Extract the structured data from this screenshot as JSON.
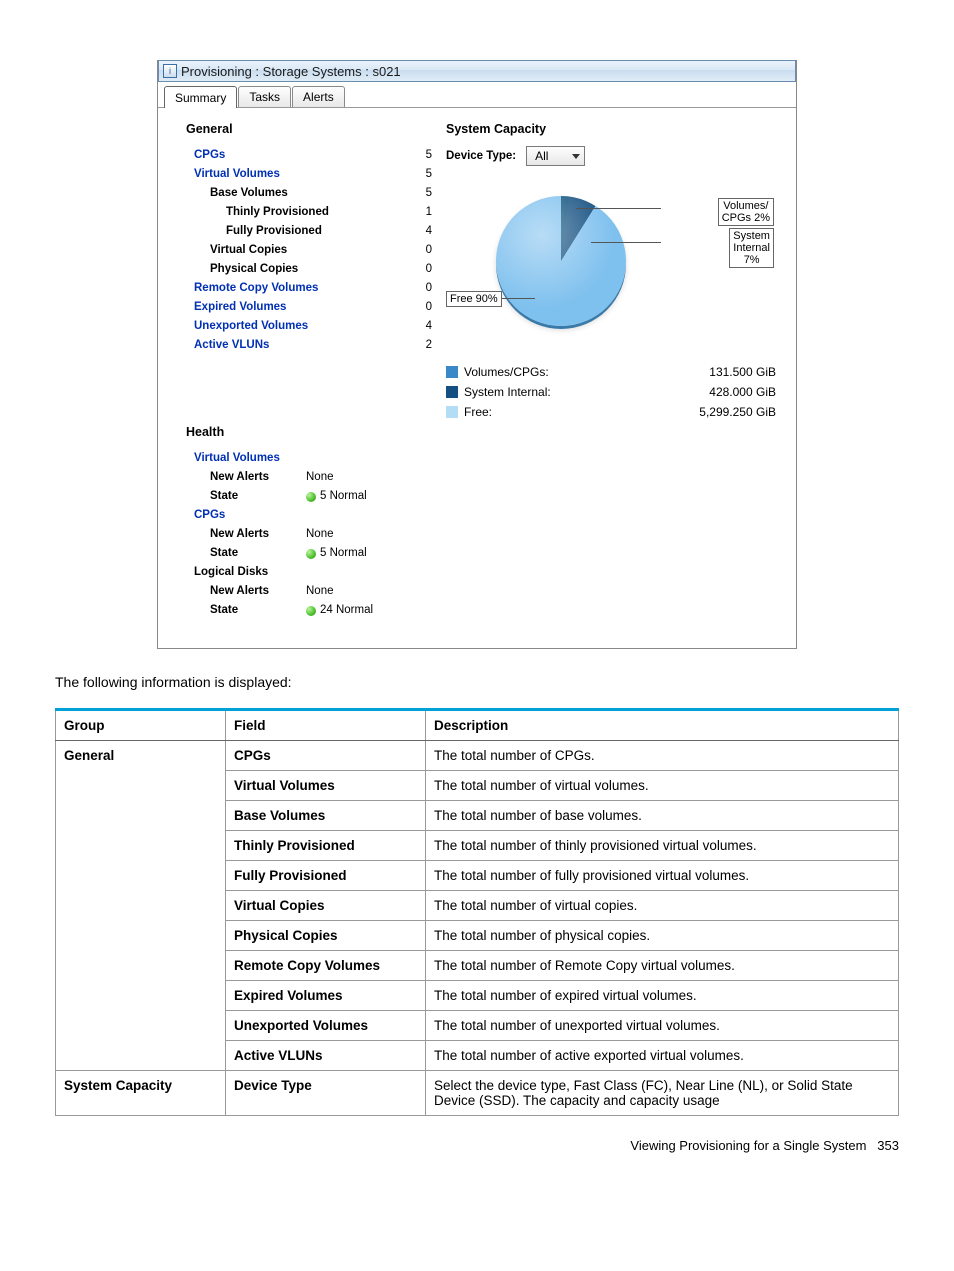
{
  "window": {
    "title": "Provisioning : Storage Systems : s021",
    "tabs": [
      "Summary",
      "Tasks",
      "Alerts"
    ],
    "active_tab": 0
  },
  "general": {
    "title": "General",
    "rows": [
      {
        "label": "CPGs",
        "link": true,
        "indent": 1,
        "value": "5"
      },
      {
        "label": "Virtual Volumes",
        "link": true,
        "indent": 1,
        "value": "5"
      },
      {
        "label": "Base Volumes",
        "link": false,
        "indent": 2,
        "value": "5"
      },
      {
        "label": "Thinly Provisioned",
        "link": false,
        "indent": 3,
        "value": "1"
      },
      {
        "label": "Fully Provisioned",
        "link": false,
        "indent": 3,
        "value": "4"
      },
      {
        "label": "Virtual Copies",
        "link": false,
        "indent": 2,
        "value": "0"
      },
      {
        "label": "Physical Copies",
        "link": false,
        "indent": 2,
        "value": "0"
      },
      {
        "label": "Remote Copy Volumes",
        "link": true,
        "indent": 1,
        "value": "0"
      },
      {
        "label": "Expired Volumes",
        "link": true,
        "indent": 1,
        "value": "0"
      },
      {
        "label": "Unexported Volumes",
        "link": true,
        "indent": 1,
        "value": "4"
      },
      {
        "label": "Active VLUNs",
        "link": true,
        "indent": 1,
        "value": "2"
      }
    ]
  },
  "capacity": {
    "title": "System Capacity",
    "device_type_label": "Device Type:",
    "device_type_value": "All",
    "callouts": {
      "volumes_cpgs": "Volumes/\nCPGs 2%",
      "system_internal": "System\nInternal\n7%",
      "free": "Free 90%"
    },
    "legend": [
      {
        "label": "Volumes/CPGs:",
        "value": "131.500 GiB",
        "sw": "sw1"
      },
      {
        "label": "System Internal:",
        "value": "428.000 GiB",
        "sw": "sw2"
      },
      {
        "label": "Free:",
        "value": "5,299.250 GiB",
        "sw": "sw3"
      }
    ]
  },
  "chart_data": {
    "type": "pie",
    "title": "System Capacity",
    "series": [
      {
        "name": "Volumes/CPGs",
        "percent": 2,
        "value_gib": 131.5
      },
      {
        "name": "System Internal",
        "percent": 7,
        "value_gib": 428.0
      },
      {
        "name": "Free",
        "percent": 90,
        "value_gib": 5299.25
      }
    ],
    "unit": "GiB"
  },
  "health": {
    "title": "Health",
    "groups": [
      {
        "name": "Virtual Volumes",
        "link": true,
        "rows": [
          {
            "label": "New Alerts",
            "value": "None",
            "dot": false
          },
          {
            "label": "State",
            "value": "5 Normal",
            "dot": true
          }
        ]
      },
      {
        "name": "CPGs",
        "link": true,
        "rows": [
          {
            "label": "New Alerts",
            "value": "None",
            "dot": false
          },
          {
            "label": "State",
            "value": "5 Normal",
            "dot": true
          }
        ]
      },
      {
        "name": "Logical Disks",
        "link": false,
        "rows": [
          {
            "label": "New Alerts",
            "value": "None",
            "dot": false
          },
          {
            "label": "State",
            "value": "24 Normal",
            "dot": true
          }
        ]
      }
    ]
  },
  "doc": {
    "intro": "The following information is displayed:"
  },
  "table": {
    "headers": [
      "Group",
      "Field",
      "Description"
    ],
    "rows": [
      {
        "group": "General",
        "field": "CPGs",
        "desc": "The total number of CPGs."
      },
      {
        "group": "",
        "field": "Virtual Volumes",
        "desc": "The total number of virtual volumes."
      },
      {
        "group": "",
        "field": "Base Volumes",
        "desc": "The total number of base volumes."
      },
      {
        "group": "",
        "field": "Thinly Provisioned",
        "desc": "The total number of thinly provisioned virtual volumes."
      },
      {
        "group": "",
        "field": "Fully Provisioned",
        "desc": "The total number of fully provisioned virtual volumes."
      },
      {
        "group": "",
        "field": "Virtual Copies",
        "desc": "The total number of virtual copies."
      },
      {
        "group": "",
        "field": "Physical Copies",
        "desc": "The total number of physical copies."
      },
      {
        "group": "",
        "field": "Remote Copy Volumes",
        "desc": "The total number of Remote Copy virtual volumes."
      },
      {
        "group": "",
        "field": "Expired Volumes",
        "desc": "The total number of expired virtual volumes."
      },
      {
        "group": "",
        "field": "Unexported Volumes",
        "desc": "The total number of unexported virtual volumes."
      },
      {
        "group": "",
        "field": "Active VLUNs",
        "desc": "The total number of active exported virtual volumes."
      },
      {
        "group": "System Capacity",
        "field": "Device Type",
        "desc": "Select the device type, Fast Class (FC), Near Line (NL), or Solid State Device (SSD). The capacity and capacity usage"
      }
    ]
  },
  "footer": {
    "text": "Viewing Provisioning for a Single System",
    "page": "353"
  }
}
